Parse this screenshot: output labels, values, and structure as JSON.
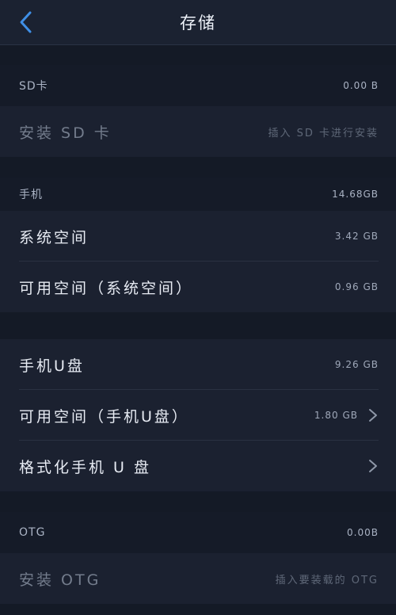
{
  "header": {
    "title": "存储",
    "back_icon": "chevron-left-icon"
  },
  "sd": {
    "section_label": "SD卡",
    "section_value": "0.00 B",
    "install_label": "安装 SD 卡",
    "install_hint": "插入 SD 卡进行安装"
  },
  "phone": {
    "section_label": "手机",
    "section_value": "14.68GB",
    "system_label": "系统空间",
    "system_value": "3.42 GB",
    "available_system_label": "可用空间（系统空间）",
    "available_system_value": "0.96 GB"
  },
  "udisk": {
    "label": "手机U盘",
    "value": "9.26 GB",
    "available_label": "可用空间（手机U盘）",
    "available_value": "1.80 GB",
    "format_label": "格式化手机 U 盘"
  },
  "otg": {
    "section_label": "OTG",
    "section_value": "0.00B",
    "install_label": "安装 OTG",
    "install_hint": "插入要装载的 OTG"
  },
  "colors": {
    "accent": "#3f8fe6",
    "background": "#141a26",
    "row": "#1b2130"
  }
}
